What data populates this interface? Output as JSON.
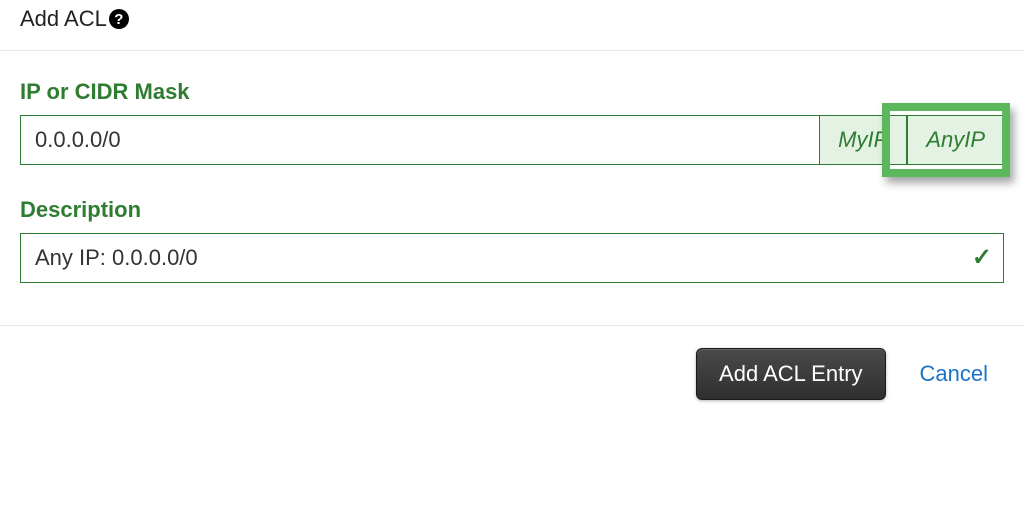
{
  "header": {
    "title": "Add ACL"
  },
  "ip": {
    "label": "IP or CIDR Mask",
    "value": "0.0.0.0/0",
    "myip_label": "MyIP",
    "anyip_label": "AnyIP"
  },
  "description": {
    "label": "Description",
    "value": "Any IP: 0.0.0.0/0"
  },
  "footer": {
    "submit_label": "Add ACL Entry",
    "cancel_label": "Cancel"
  }
}
